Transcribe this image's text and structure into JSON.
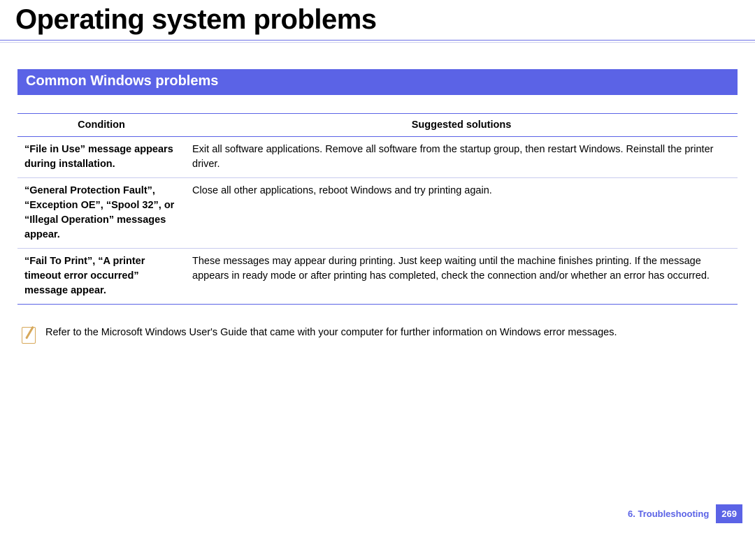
{
  "title": "Operating system problems",
  "section": "Common Windows problems",
  "headers": {
    "condition": "Condition",
    "solutions": "Suggested solutions"
  },
  "rows": [
    {
      "condition": "“File in Use” message appears during installation.",
      "solution": "Exit all software applications. Remove all software from the startup group, then restart Windows. Reinstall the printer driver."
    },
    {
      "condition": "“General Protection Fault”, “Exception OE”, “Spool 32”, or “Illegal Operation” messages appear.",
      "solution": "Close all other applications, reboot Windows and try printing again."
    },
    {
      "condition": "“Fail To Print”, “A printer timeout error occurred” message appear.",
      "solution": "These messages may appear during printing. Just keep waiting until the machine finishes printing. If the message appears in ready mode or after printing has completed, check the connection and/or whether an error has occurred."
    }
  ],
  "note": "Refer to the Microsoft Windows User's Guide that came with your computer for further information on Windows error messages.",
  "footer": {
    "chapter": "6.  Troubleshooting",
    "page": "269"
  }
}
